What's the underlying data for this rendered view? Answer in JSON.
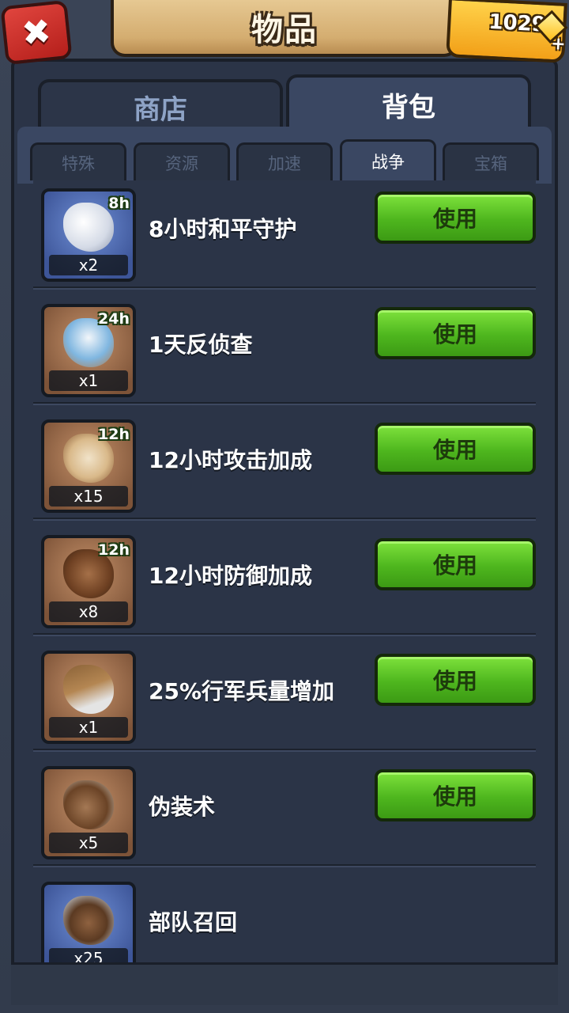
{
  "header": {
    "title": "物品"
  },
  "close_label": "✖",
  "gems": {
    "value": "1029",
    "plus": "+"
  },
  "main_tabs": [
    {
      "label": "商店",
      "active": false
    },
    {
      "label": "背包",
      "active": true
    }
  ],
  "sub_tabs": [
    {
      "label": "特殊",
      "active": false
    },
    {
      "label": "资源",
      "active": false
    },
    {
      "label": "加速",
      "active": false
    },
    {
      "label": "战争",
      "active": true
    },
    {
      "label": "宝箱",
      "active": false
    }
  ],
  "items": [
    {
      "name": "8小时和平守护",
      "count": "x2",
      "duration": "8h",
      "icon": "dove-icon",
      "button": "使用"
    },
    {
      "name": "1天反侦查",
      "count": "x1",
      "duration": "24h",
      "icon": "anti-scout-icon",
      "button": "使用"
    },
    {
      "name": "12小时攻击加成",
      "count": "x15",
      "duration": "12h",
      "icon": "attack-boost-icon",
      "button": "使用"
    },
    {
      "name": "12小时防御加成",
      "count": "x8",
      "duration": "12h",
      "icon": "defense-boost-icon",
      "button": "使用"
    },
    {
      "name": "25%行军兵量增加",
      "count": "x1",
      "duration": "",
      "icon": "march-size-icon",
      "button": "使用"
    },
    {
      "name": "伪装术",
      "count": "x5",
      "duration": "",
      "icon": "disguise-icon",
      "button": "使用"
    },
    {
      "name": "部队召回",
      "count": "x25",
      "duration": "",
      "icon": "troop-recall-icon",
      "button": ""
    }
  ]
}
